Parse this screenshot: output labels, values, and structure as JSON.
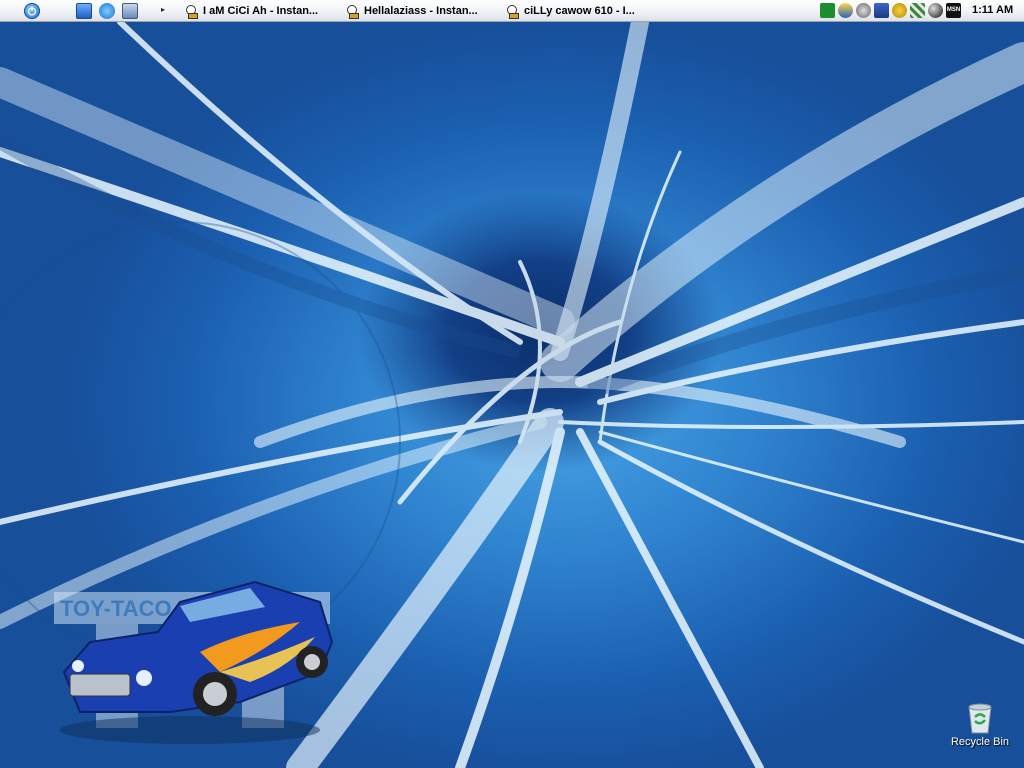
{
  "taskbar": {
    "tasks": [
      {
        "label": "I aM CiCi Ah - Instan..."
      },
      {
        "label": "Hellalaziass - Instan..."
      },
      {
        "label": "ciLLy cawow 610 - I..."
      }
    ],
    "clock": "1:11 AM",
    "tray_icons": [
      "xfire-icon",
      "aim-icon",
      "speaker-icon",
      "network-icon",
      "norton-icon",
      "grid-icon",
      "sphere-icon",
      "msn-icon"
    ]
  },
  "desktop": {
    "wallpaper_text": "TOY-TACO",
    "icons": [
      {
        "label": "Recycle Bin"
      }
    ]
  },
  "colors": {
    "accent": "#1e6fd0",
    "desktop_bg": "#2f83cf"
  }
}
